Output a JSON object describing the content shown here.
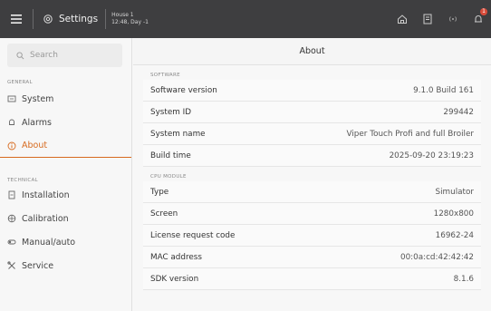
{
  "topbar": {
    "settings_label": "Settings",
    "house_name": "House 1",
    "house_time": "12:48, Day -1",
    "badge": "1",
    "colors": {
      "bg": "#3e3e40",
      "badge": "#d84b3a"
    },
    "icons": [
      "menu-icon",
      "settings-gear-icon",
      "house-icon",
      "document-icon",
      "signal-icon",
      "notification-bell-icon"
    ]
  },
  "sidebar": {
    "search_placeholder": "Search",
    "general_header": "GENERAL",
    "general_items": [
      {
        "label": "System",
        "icon": "system-icon"
      },
      {
        "label": "Alarms",
        "icon": "bell-icon"
      },
      {
        "label": "About",
        "icon": "info-icon",
        "active": true
      }
    ],
    "technical_header": "TECHNICAL",
    "technical_items": [
      {
        "label": "Installation",
        "icon": "installation-icon"
      },
      {
        "label": "Calibration",
        "icon": "calibration-icon"
      },
      {
        "label": "Manual/auto",
        "icon": "manual-auto-icon"
      },
      {
        "label": "Service",
        "icon": "service-tools-icon"
      }
    ],
    "accent_color": "#d76a1e"
  },
  "main": {
    "title": "About",
    "software": {
      "header": "SOFTWARE",
      "rows": [
        {
          "key": "Software version",
          "value": "9.1.0 Build 161"
        },
        {
          "key": "System ID",
          "value": "299442"
        },
        {
          "key": "System name",
          "value": "Viper Touch Profi and full Broiler"
        },
        {
          "key": "Build time",
          "value": "2025-09-20 23:19:23"
        }
      ]
    },
    "cpu": {
      "header": "CPU MODULE",
      "rows": [
        {
          "key": "Type",
          "value": "Simulator"
        },
        {
          "key": "Screen",
          "value": "1280x800"
        },
        {
          "key": "License request code",
          "value": "16962-24"
        },
        {
          "key": "MAC address",
          "value": "00:0a:cd:42:42:42"
        },
        {
          "key": "SDK version",
          "value": "8.1.6"
        }
      ]
    }
  }
}
